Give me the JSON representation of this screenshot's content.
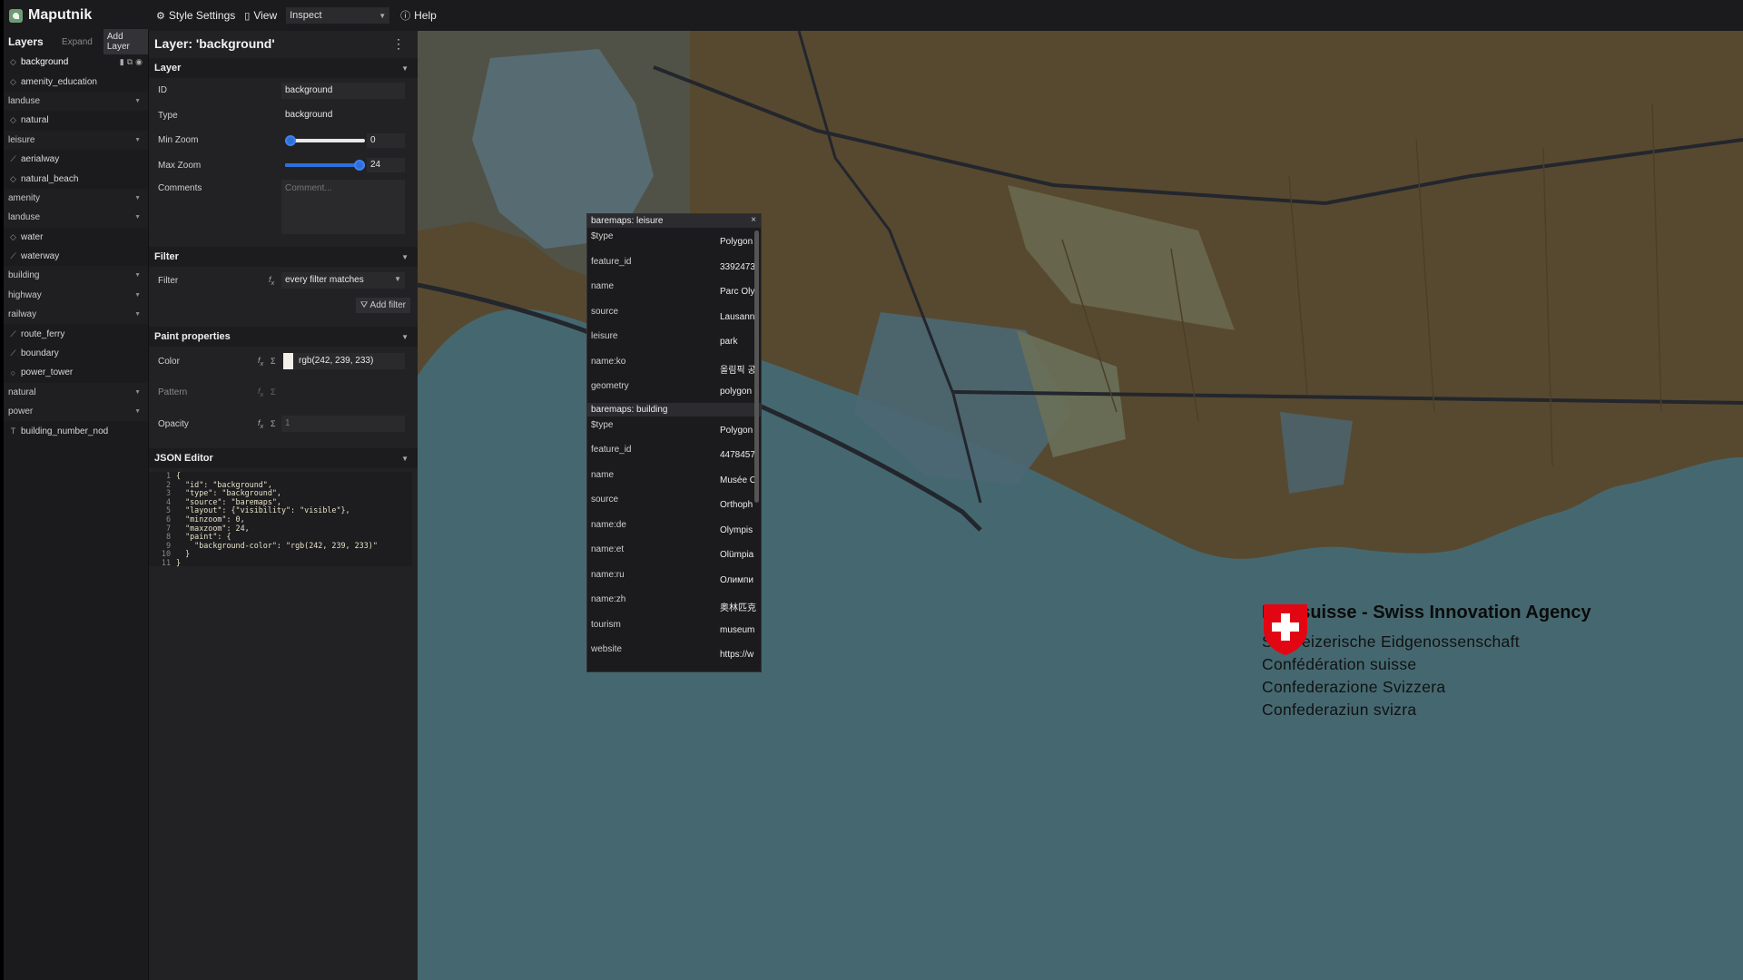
{
  "app": {
    "name": "Maputnik",
    "menu": {
      "style_settings": "Style Settings",
      "view": "View",
      "view_mode": "Inspect",
      "help": "Help"
    }
  },
  "layer_list": {
    "title": "Layers",
    "expand": "Expand",
    "add_layer": "Add Layer",
    "items": [
      {
        "label": "background",
        "icon": "fill-icon",
        "group": false,
        "active": true
      },
      {
        "label": "amenity_education",
        "icon": "fill-icon",
        "group": false
      },
      {
        "label": "landuse",
        "group": true
      },
      {
        "label": "natural",
        "icon": "fill-icon",
        "group": false
      },
      {
        "label": "leisure",
        "group": true
      },
      {
        "label": "aerialway",
        "icon": "line-icon",
        "group": false
      },
      {
        "label": "natural_beach",
        "icon": "fill-icon",
        "group": false
      },
      {
        "label": "amenity",
        "group": true
      },
      {
        "label": "landuse",
        "group": true
      },
      {
        "label": "water",
        "icon": "fill-icon",
        "group": false
      },
      {
        "label": "waterway",
        "icon": "line-icon",
        "group": false
      },
      {
        "label": "building",
        "group": true
      },
      {
        "label": "highway",
        "group": true
      },
      {
        "label": "railway",
        "group": true
      },
      {
        "label": "route_ferry",
        "icon": "line-icon",
        "group": false
      },
      {
        "label": "boundary",
        "icon": "line-icon",
        "group": false
      },
      {
        "label": "power_tower",
        "icon": "circle-icon",
        "group": false
      },
      {
        "label": "natural",
        "group": true
      },
      {
        "label": "power",
        "group": true
      },
      {
        "label": "building_number_nod",
        "icon": "symbol-icon",
        "group": false
      }
    ]
  },
  "editor": {
    "title": "Layer: 'background'",
    "layer_section": "Layer",
    "id_label": "ID",
    "id_value": "background",
    "type_label": "Type",
    "type_value": "background",
    "minzoom_label": "Min Zoom",
    "minzoom_value": "0",
    "minzoom_fraction": 0,
    "maxzoom_label": "Max Zoom",
    "maxzoom_value": "24",
    "maxzoom_fraction": 1,
    "comments_label": "Comments",
    "comments_placeholder": "Comment...",
    "filter_section": "Filter",
    "filter_label": "Filter",
    "filter_value": "every filter matches",
    "add_filter": "Add filter",
    "paint_section": "Paint properties",
    "color_label": "Color",
    "color_value": "rgb(242, 239, 233)",
    "pattern_label": "Pattern",
    "opacity_label": "Opacity",
    "opacity_value": "1",
    "json_section": "JSON Editor",
    "json_lines": [
      "{",
      "  \"id\": \"background\",",
      "  \"type\": \"background\",",
      "  \"source\": \"baremaps\",",
      "  \"layout\": {\"visibility\": \"visible\"},",
      "  \"minzoom\": 0,",
      "  \"maxzoom\": 24,",
      "  \"paint\": {",
      "    \"background-color\": \"rgb(242, 239, 233)\"",
      "  }",
      "}"
    ]
  },
  "popup": {
    "sections": [
      {
        "title": "baremaps: leisure",
        "rows": [
          {
            "k": "$type",
            "v": "Polygon"
          },
          {
            "k": "feature_id",
            "v": "3392473"
          },
          {
            "k": "name",
            "v": "Parc Oly"
          },
          {
            "k": "source",
            "v": "Lausann"
          },
          {
            "k": "leisure",
            "v": "park"
          },
          {
            "k": "name:ko",
            "v": "올림픽 공"
          },
          {
            "k": "geometry",
            "v": "polygon"
          }
        ]
      },
      {
        "title": "baremaps: building",
        "rows": [
          {
            "k": "$type",
            "v": "Polygon"
          },
          {
            "k": "feature_id",
            "v": "4478457"
          },
          {
            "k": "name",
            "v": "Musée O"
          },
          {
            "k": "source",
            "v": "Orthoph"
          },
          {
            "k": "name:de",
            "v": "Olympis"
          },
          {
            "k": "name:et",
            "v": "Olümpia"
          },
          {
            "k": "name:ru",
            "v": "Олимпи"
          },
          {
            "k": "name:zh",
            "v": "奥林匹克"
          },
          {
            "k": "tourism",
            "v": "museum"
          },
          {
            "k": "website",
            "v": "https://w"
          }
        ]
      }
    ]
  },
  "agency": {
    "title": "Innosuisse - Swiss Innovation Agency",
    "lines": [
      "Schweizerische Eidgenossenschaft",
      "Confédération suisse",
      "Confederazione Svizzera",
      "Confederaziun svizra"
    ]
  },
  "colors": {
    "land": "#57492f",
    "water": "#456870",
    "accent": "#2e6fdc",
    "road": "#23262d",
    "swiss_red": "#e20613"
  }
}
